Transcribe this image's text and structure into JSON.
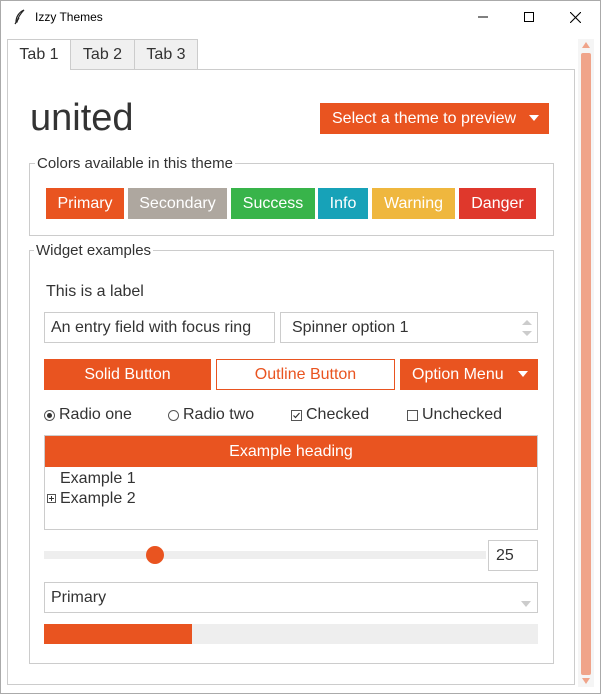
{
  "window": {
    "title": "Izzy Themes"
  },
  "tabs": [
    {
      "label": "Tab 1"
    },
    {
      "label": "Tab 2"
    },
    {
      "label": "Tab 3"
    }
  ],
  "header": {
    "theme_name": "united",
    "theme_select": "Select a theme to preview"
  },
  "colors_frame": {
    "label": "Colors available in this theme",
    "buttons": [
      {
        "label": "Primary",
        "color": "#e95420"
      },
      {
        "label": "Secondary",
        "color": "#aea79f"
      },
      {
        "label": "Success",
        "color": "#38b44a"
      },
      {
        "label": "Info",
        "color": "#17a2b8"
      },
      {
        "label": "Warning",
        "color": "#efb73e"
      },
      {
        "label": "Danger",
        "color": "#df382c"
      }
    ]
  },
  "widgets": {
    "label": "Widget examples",
    "static_label": "This is a label",
    "entry_value": "An entry field with focus ring",
    "spinner_value": "Spinner option 1",
    "solid_button": "Solid Button",
    "outline_button": "Outline Button",
    "option_menu": "Option Menu",
    "radio_one": "Radio one",
    "radio_two": "Radio two",
    "checked": "Checked",
    "unchecked": "Unchecked",
    "tree_heading": "Example heading",
    "tree_items": [
      "Example 1",
      "Example 2"
    ],
    "scale_value": "25",
    "scale_fraction": 0.25,
    "combo_value": "Primary",
    "progress_fraction": 0.3
  },
  "accent_color": "#e95420"
}
